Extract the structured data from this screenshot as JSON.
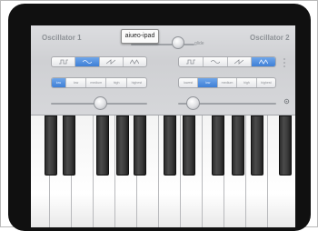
{
  "tooltip": {
    "label": "aiueo-ipad"
  },
  "oscillators": [
    {
      "title": "Oscillator 1",
      "waveforms": [
        "square-wave",
        "sine-wave",
        "saw-wave",
        "triangle-wave"
      ],
      "waveform_selected_index": 1,
      "ranges": [
        "low",
        "low",
        "medium",
        "high",
        "highest"
      ],
      "range_selected_index": 0
    },
    {
      "title": "Oscillator 2",
      "waveforms": [
        "square-wave",
        "sine-wave",
        "saw-wave",
        "triangle-wave"
      ],
      "waveform_selected_index": 3,
      "ranges": [
        "lowest",
        "low",
        "medium",
        "high",
        "highest"
      ],
      "range_selected_index": 1
    }
  ],
  "glide": {
    "label": "glide"
  },
  "colors": {
    "accent": "#4a88dc",
    "bezel": "#101010",
    "panel": "#d3d4d7"
  }
}
